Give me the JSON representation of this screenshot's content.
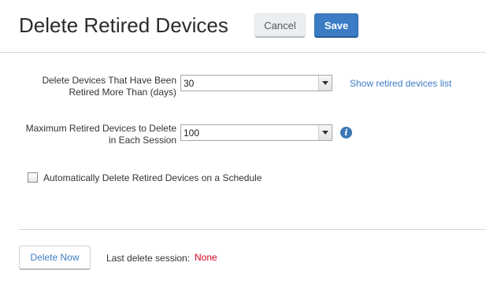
{
  "header": {
    "title": "Delete Retired Devices",
    "cancel_label": "Cancel",
    "save_label": "Save"
  },
  "form": {
    "retired_days": {
      "label_line1": "Delete Devices That Have Been",
      "label_line2": "Retired More Than (days)",
      "value": "30",
      "link_label": "Show retired devices list"
    },
    "max_devices": {
      "label_line1": "Maximum Retired Devices to Delete",
      "label_line2": "in Each Session",
      "value": "100",
      "info_glyph": "i"
    },
    "schedule": {
      "label": "Automatically Delete Retired Devices on a Schedule",
      "checked": false
    }
  },
  "footer": {
    "delete_now_label": "Delete Now",
    "last_session_label": "Last delete session:",
    "last_session_value": "None"
  },
  "colors": {
    "accent": "#3c7cc4",
    "status_none": "#d0021b"
  }
}
